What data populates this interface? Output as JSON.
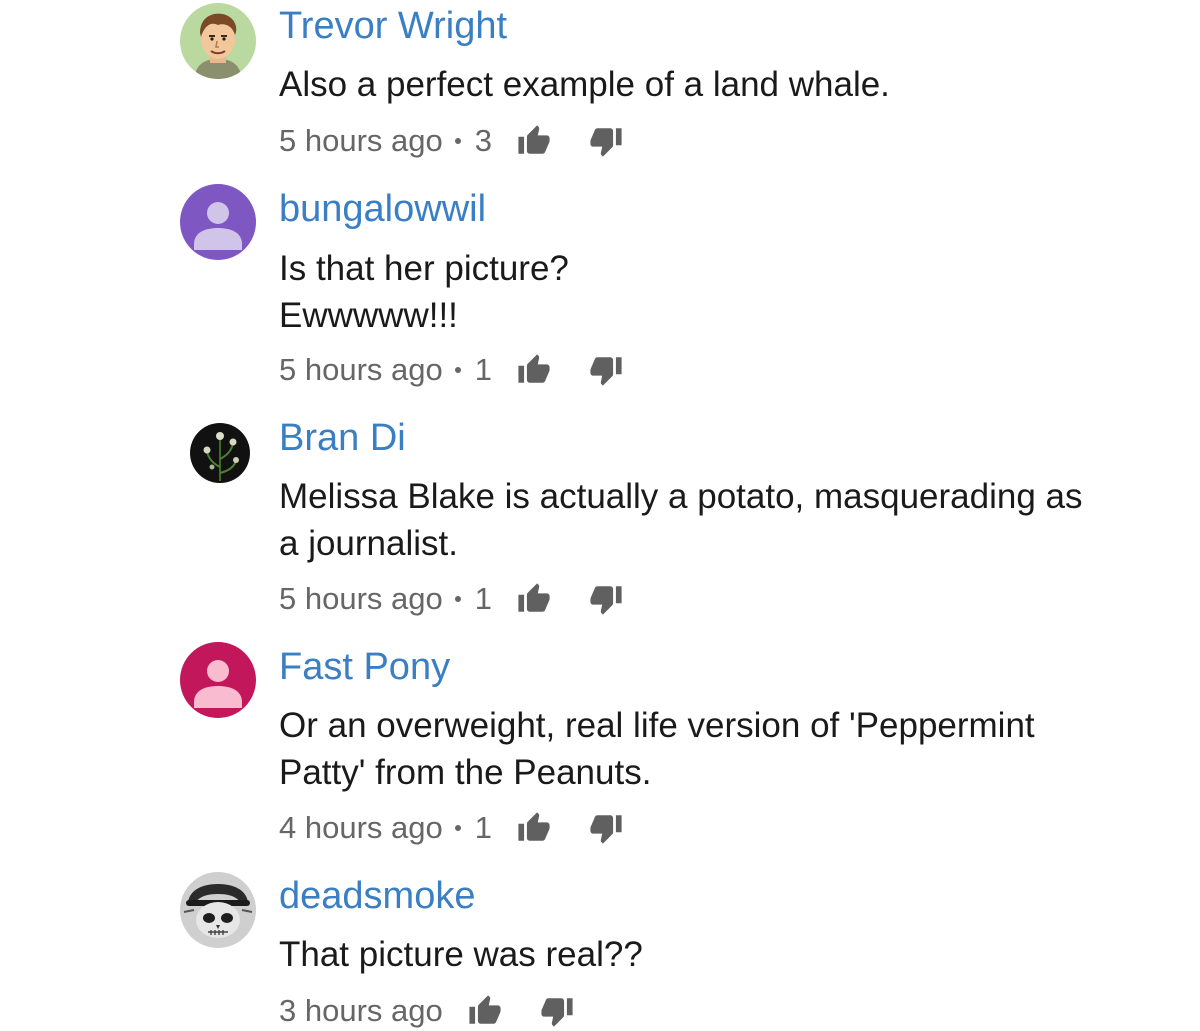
{
  "comments": [
    {
      "author": "Trevor Wright",
      "lines": [
        "Also a perfect example of a land whale."
      ],
      "time": "5 hours ago",
      "likes": "3",
      "avatar": {
        "type": "cartoon-face",
        "bg": "#b9d9a1"
      }
    },
    {
      "author": "bungalowwil",
      "lines": [
        "Is that her picture?",
        "Ewwwww!!!"
      ],
      "time": "5 hours ago",
      "likes": "1",
      "avatar": {
        "type": "default-person",
        "bg": "#7e57c2"
      }
    },
    {
      "author": "Bran Di",
      "lines": [
        "Melissa Blake is actually a potato, masquerading as",
        "a journalist."
      ],
      "time": "5 hours ago",
      "likes": "1",
      "avatar": {
        "type": "plant-photo",
        "bg": "#111111"
      }
    },
    {
      "author": "Fast Pony",
      "lines": [
        "Or an overweight, real life version of 'Peppermint",
        "Patty' from the Peanuts."
      ],
      "time": "4 hours ago",
      "likes": "1",
      "avatar": {
        "type": "default-person",
        "bg": "#c2185b"
      }
    },
    {
      "author": "deadsmoke",
      "lines": [
        "That picture was real??"
      ],
      "time": "3 hours ago",
      "likes": "",
      "avatar": {
        "type": "skull-photo",
        "bg": "#cfcfcf"
      }
    }
  ],
  "icons": {
    "like": "thumbs-up-icon",
    "dislike": "thumbs-down-icon"
  },
  "colors": {
    "author_link": "#3a7fc4",
    "body_text": "#1a1a1a",
    "meta_text": "#666666",
    "icon": "#606060"
  }
}
